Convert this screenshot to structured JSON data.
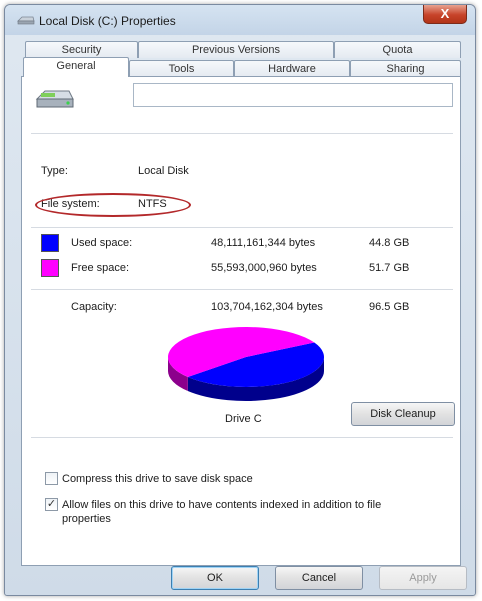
{
  "window": {
    "title": "Local Disk (C:) Properties",
    "close_glyph": "X"
  },
  "tabs": {
    "row1": [
      "Security",
      "Previous Versions",
      "Quota"
    ],
    "row2": [
      "General",
      "Tools",
      "Hardware",
      "Sharing"
    ],
    "active": "General"
  },
  "general": {
    "name_value": "",
    "type_label": "Type:",
    "type_value": "Local Disk",
    "fs_label": "File system:",
    "fs_value": "NTFS",
    "used": {
      "label": "Used space:",
      "bytes": "48,111,161,344 bytes",
      "size": "44.8 GB",
      "color": "#0000ff"
    },
    "free": {
      "label": "Free space:",
      "bytes": "55,593,000,960 bytes",
      "size": "51.7 GB",
      "color": "#ff00ff"
    },
    "capacity": {
      "label": "Capacity:",
      "bytes": "103,704,162,304 bytes",
      "size": "96.5 GB"
    },
    "drive_label": "Drive C",
    "cleanup_label": "Disk Cleanup",
    "compress_label": "Compress this drive to save disk space",
    "index_label_line1": "Allow files on this drive to have contents indexed in addition to file",
    "index_label_line2": "properties",
    "compress_checked": false,
    "index_checked": true
  },
  "buttons": {
    "ok": "OK",
    "cancel": "Cancel",
    "apply": "Apply"
  },
  "chart_data": {
    "type": "pie",
    "categories": [
      "Used space",
      "Free space"
    ],
    "values": [
      48111161344,
      55593000960
    ],
    "colors": [
      "#0000ff",
      "#ff00ff"
    ],
    "title": "Drive C"
  }
}
